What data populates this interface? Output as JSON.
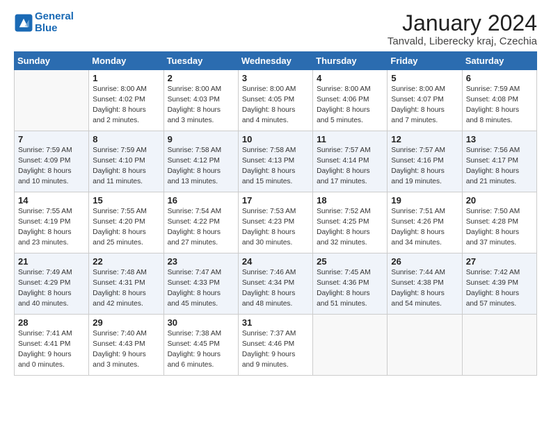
{
  "header": {
    "logo_line1": "General",
    "logo_line2": "Blue",
    "month": "January 2024",
    "location": "Tanvald, Liberecky kraj, Czechia"
  },
  "weekdays": [
    "Sunday",
    "Monday",
    "Tuesday",
    "Wednesday",
    "Thursday",
    "Friday",
    "Saturday"
  ],
  "weeks": [
    [
      {
        "day": "",
        "info": ""
      },
      {
        "day": "1",
        "info": "Sunrise: 8:00 AM\nSunset: 4:02 PM\nDaylight: 8 hours\nand 2 minutes."
      },
      {
        "day": "2",
        "info": "Sunrise: 8:00 AM\nSunset: 4:03 PM\nDaylight: 8 hours\nand 3 minutes."
      },
      {
        "day": "3",
        "info": "Sunrise: 8:00 AM\nSunset: 4:05 PM\nDaylight: 8 hours\nand 4 minutes."
      },
      {
        "day": "4",
        "info": "Sunrise: 8:00 AM\nSunset: 4:06 PM\nDaylight: 8 hours\nand 5 minutes."
      },
      {
        "day": "5",
        "info": "Sunrise: 8:00 AM\nSunset: 4:07 PM\nDaylight: 8 hours\nand 7 minutes."
      },
      {
        "day": "6",
        "info": "Sunrise: 7:59 AM\nSunset: 4:08 PM\nDaylight: 8 hours\nand 8 minutes."
      }
    ],
    [
      {
        "day": "7",
        "info": "Sunrise: 7:59 AM\nSunset: 4:09 PM\nDaylight: 8 hours\nand 10 minutes."
      },
      {
        "day": "8",
        "info": "Sunrise: 7:59 AM\nSunset: 4:10 PM\nDaylight: 8 hours\nand 11 minutes."
      },
      {
        "day": "9",
        "info": "Sunrise: 7:58 AM\nSunset: 4:12 PM\nDaylight: 8 hours\nand 13 minutes."
      },
      {
        "day": "10",
        "info": "Sunrise: 7:58 AM\nSunset: 4:13 PM\nDaylight: 8 hours\nand 15 minutes."
      },
      {
        "day": "11",
        "info": "Sunrise: 7:57 AM\nSunset: 4:14 PM\nDaylight: 8 hours\nand 17 minutes."
      },
      {
        "day": "12",
        "info": "Sunrise: 7:57 AM\nSunset: 4:16 PM\nDaylight: 8 hours\nand 19 minutes."
      },
      {
        "day": "13",
        "info": "Sunrise: 7:56 AM\nSunset: 4:17 PM\nDaylight: 8 hours\nand 21 minutes."
      }
    ],
    [
      {
        "day": "14",
        "info": "Sunrise: 7:55 AM\nSunset: 4:19 PM\nDaylight: 8 hours\nand 23 minutes."
      },
      {
        "day": "15",
        "info": "Sunrise: 7:55 AM\nSunset: 4:20 PM\nDaylight: 8 hours\nand 25 minutes."
      },
      {
        "day": "16",
        "info": "Sunrise: 7:54 AM\nSunset: 4:22 PM\nDaylight: 8 hours\nand 27 minutes."
      },
      {
        "day": "17",
        "info": "Sunrise: 7:53 AM\nSunset: 4:23 PM\nDaylight: 8 hours\nand 30 minutes."
      },
      {
        "day": "18",
        "info": "Sunrise: 7:52 AM\nSunset: 4:25 PM\nDaylight: 8 hours\nand 32 minutes."
      },
      {
        "day": "19",
        "info": "Sunrise: 7:51 AM\nSunset: 4:26 PM\nDaylight: 8 hours\nand 34 minutes."
      },
      {
        "day": "20",
        "info": "Sunrise: 7:50 AM\nSunset: 4:28 PM\nDaylight: 8 hours\nand 37 minutes."
      }
    ],
    [
      {
        "day": "21",
        "info": "Sunrise: 7:49 AM\nSunset: 4:29 PM\nDaylight: 8 hours\nand 40 minutes."
      },
      {
        "day": "22",
        "info": "Sunrise: 7:48 AM\nSunset: 4:31 PM\nDaylight: 8 hours\nand 42 minutes."
      },
      {
        "day": "23",
        "info": "Sunrise: 7:47 AM\nSunset: 4:33 PM\nDaylight: 8 hours\nand 45 minutes."
      },
      {
        "day": "24",
        "info": "Sunrise: 7:46 AM\nSunset: 4:34 PM\nDaylight: 8 hours\nand 48 minutes."
      },
      {
        "day": "25",
        "info": "Sunrise: 7:45 AM\nSunset: 4:36 PM\nDaylight: 8 hours\nand 51 minutes."
      },
      {
        "day": "26",
        "info": "Sunrise: 7:44 AM\nSunset: 4:38 PM\nDaylight: 8 hours\nand 54 minutes."
      },
      {
        "day": "27",
        "info": "Sunrise: 7:42 AM\nSunset: 4:39 PM\nDaylight: 8 hours\nand 57 minutes."
      }
    ],
    [
      {
        "day": "28",
        "info": "Sunrise: 7:41 AM\nSunset: 4:41 PM\nDaylight: 9 hours\nand 0 minutes."
      },
      {
        "day": "29",
        "info": "Sunrise: 7:40 AM\nSunset: 4:43 PM\nDaylight: 9 hours\nand 3 minutes."
      },
      {
        "day": "30",
        "info": "Sunrise: 7:38 AM\nSunset: 4:45 PM\nDaylight: 9 hours\nand 6 minutes."
      },
      {
        "day": "31",
        "info": "Sunrise: 7:37 AM\nSunset: 4:46 PM\nDaylight: 9 hours\nand 9 minutes."
      },
      {
        "day": "",
        "info": ""
      },
      {
        "day": "",
        "info": ""
      },
      {
        "day": "",
        "info": ""
      }
    ]
  ]
}
